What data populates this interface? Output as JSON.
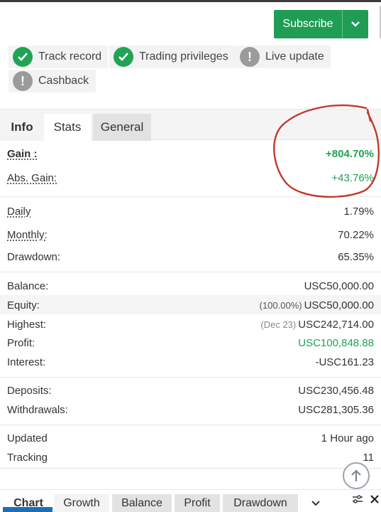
{
  "header": {
    "subscribe_label": "Subscribe"
  },
  "badges": [
    {
      "label": "Track record",
      "status": "ok"
    },
    {
      "label": "Trading privileges",
      "status": "ok"
    },
    {
      "label": "Live update",
      "status": "warn"
    },
    {
      "label": "Cashback",
      "status": "warn"
    }
  ],
  "tabs": {
    "info": "Info",
    "stats": "Stats",
    "general": "General"
  },
  "stats": {
    "gain": {
      "label": "Gain :",
      "value": "+804.70%"
    },
    "abs_gain": {
      "label": "Abs. Gain:",
      "value": "+43.76%"
    },
    "daily": {
      "label": "Daily",
      "value": "1.79%"
    },
    "monthly": {
      "label": "Monthly:",
      "value": "70.22%"
    },
    "drawdown": {
      "label": "Drawdown:",
      "value": "65.35%"
    },
    "balance": {
      "label": "Balance:",
      "value": "USC50,000.00"
    },
    "equity": {
      "label": "Equity:",
      "note": "(100.00%)",
      "value": "USC50,000.00"
    },
    "highest": {
      "label": "Highest:",
      "note": "(Dec 23)",
      "value": "USC242,714.00"
    },
    "profit": {
      "label": "Profit:",
      "value": "USC100,848.88"
    },
    "interest": {
      "label": "Interest:",
      "value": "-USC161.23"
    },
    "deposits": {
      "label": "Deposits:",
      "value": "USC230,456.48"
    },
    "withdrawals": {
      "label": "Withdrawals:",
      "value": "USC281,305.36"
    },
    "updated": {
      "label": "Updated",
      "value": "1 Hour ago"
    },
    "tracking": {
      "label": "Tracking",
      "value": "11"
    }
  },
  "bottom_tabs": {
    "chart": "Chart",
    "growth": "Growth",
    "balance": "Balance",
    "profit": "Profit",
    "drawdown": "Drawdown"
  },
  "colors": {
    "accent_green": "#1fa350",
    "subscribe_bg": "#1f9d55",
    "annotation_red": "#c0392b",
    "tab_blue": "#1a6fb9"
  }
}
